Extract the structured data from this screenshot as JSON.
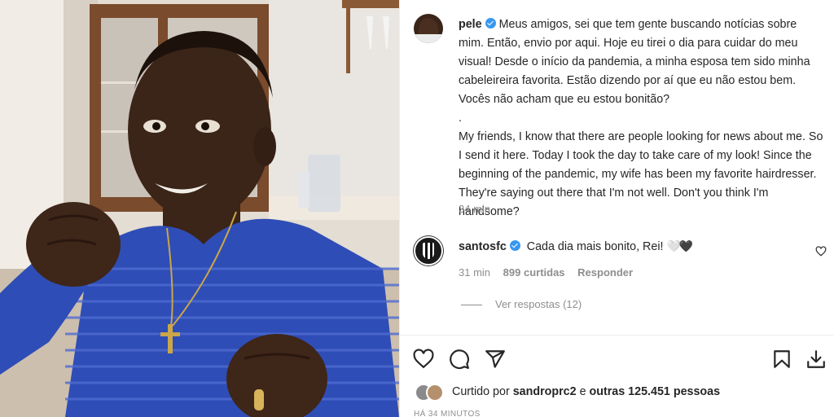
{
  "post": {
    "author": "pele",
    "caption_pt": "Meus amigos, sei que tem gente buscando notícias sobre mim. Então, envio por aqui. Hoje eu tirei o dia para cuidar do meu visual! Desde o início da pandemia, a minha esposa tem sido minha cabeleireira favorita. Estão dizendo por aí que eu não estou bem. Vocês não acham que eu estou bonitão?",
    "separator": ".",
    "caption_en": "My friends, I know that there are people looking for news about me. So I send it here. Today I took the day to take care of my look! Since the beginning of the pandemic, my wife has been my favorite hairdresser. They're saying out there that I'm not well. Don't you think I'm handsome?",
    "time": "34 min"
  },
  "comment": {
    "author": "santosfc",
    "text": "Cada dia mais bonito, Rei!",
    "hearts": [
      "🤍",
      "🖤"
    ],
    "time": "31 min",
    "likes": "899 curtidas",
    "reply": "Responder",
    "view_replies": "Ver respostas (12)"
  },
  "actions": {
    "icons": [
      "heart-icon",
      "comment-icon",
      "share-icon",
      "bookmark-icon",
      "download-icon"
    ]
  },
  "likes": {
    "prefix": "Curtido por",
    "user": "sandroprc2",
    "middle": "e",
    "others": "outras 125.451 pessoas"
  },
  "post_date": "HÁ 34 MINUTOS",
  "colors": {
    "shirt": "#2f4db6",
    "verified": "#3897f0",
    "meta_text": "#8e8e8e"
  }
}
